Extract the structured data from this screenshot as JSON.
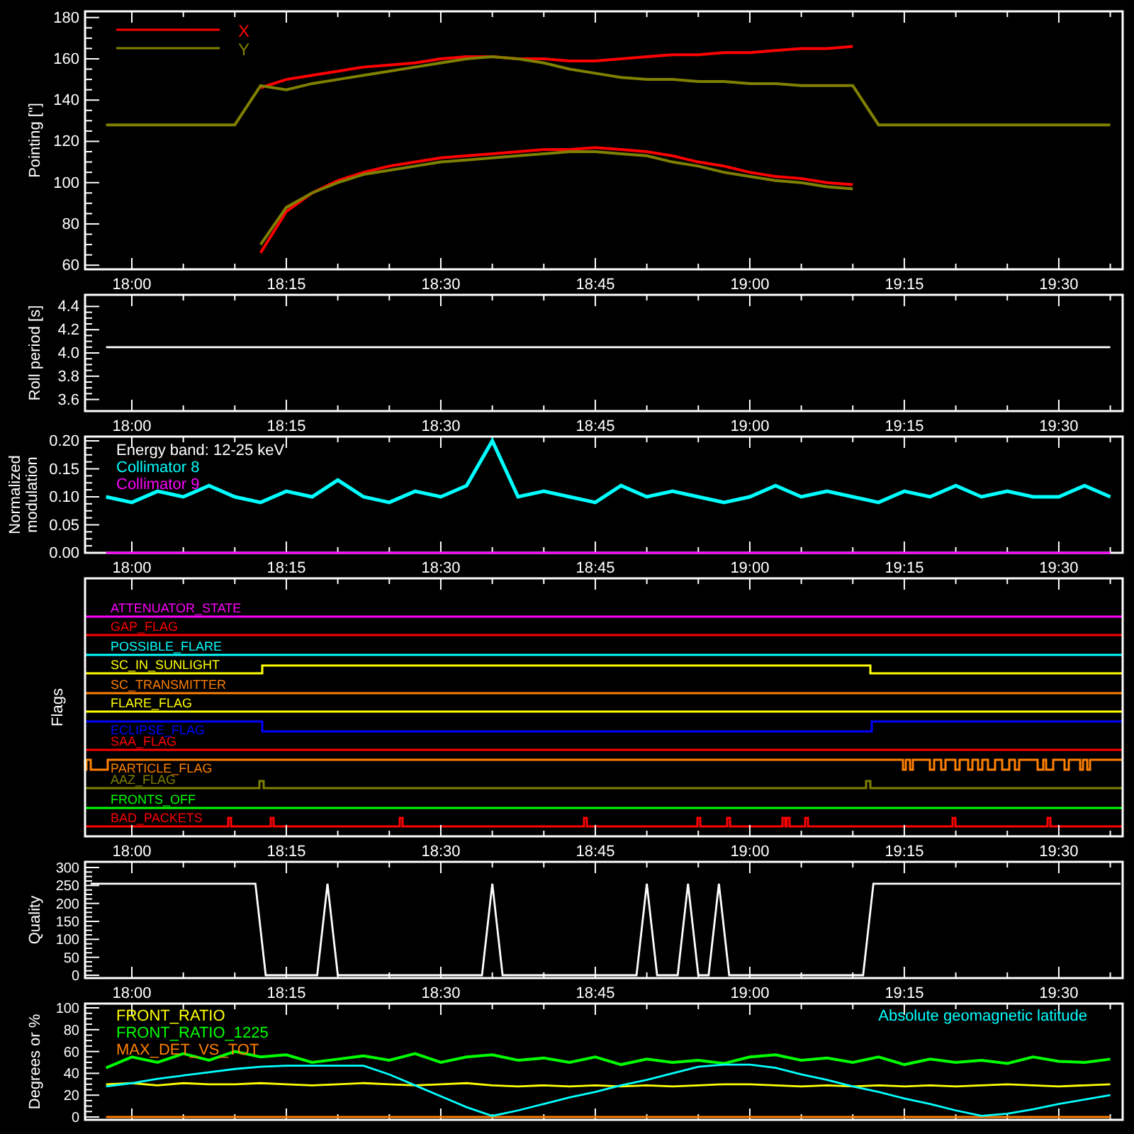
{
  "panels": [
    {
      "kind": "pointing",
      "legend": [
        {
          "label": "X",
          "color": "#ff0000"
        },
        {
          "label": "Y",
          "color": "#808000"
        }
      ],
      "chart_data": {
        "type": "line",
        "ylabel": "Pointing [\"]",
        "ylim": [
          58,
          183
        ],
        "categories": [
          null,
          "18:00",
          null,
          null,
          null,
          null,
          null,
          "18:15",
          null,
          null,
          null,
          null,
          null,
          "18:30",
          null,
          null,
          null,
          null,
          null,
          "18:45",
          null,
          null,
          null,
          null,
          null,
          "19:00",
          null,
          null,
          null,
          null,
          null,
          "19:15",
          null,
          null,
          null,
          null,
          null,
          "19:30",
          null,
          null
        ],
        "yticks": [
          {
            "value": 60,
            "label": "60"
          },
          {
            "value": 80,
            "label": "80"
          },
          {
            "value": 100,
            "label": "100"
          },
          {
            "value": 120,
            "label": "120"
          },
          {
            "value": 140,
            "label": "140"
          },
          {
            "value": 160,
            "label": "160"
          },
          {
            "value": 180,
            "label": "180"
          }
        ],
        "series": [
          {
            "color": "#ff0000",
            "values": [
              null,
              null,
              null,
              null,
              null,
              null,
              146,
              150,
              152,
              154,
              156,
              157,
              158,
              160,
              161,
              161,
              160,
              160,
              159,
              159,
              160,
              161,
              162,
              162,
              163,
              163,
              164,
              165,
              165,
              166,
              null,
              null,
              null,
              null,
              null,
              null,
              null,
              null,
              null,
              null
            ]
          },
          {
            "color": "#ff0000",
            "values": [
              null,
              null,
              null,
              null,
              null,
              null,
              66,
              86,
              95,
              101,
              105,
              108,
              110,
              112,
              113,
              114,
              115,
              116,
              116,
              117,
              116,
              115,
              113,
              110,
              108,
              105,
              103,
              102,
              100,
              99,
              null,
              null,
              null,
              null,
              null,
              null,
              null,
              null,
              null,
              null
            ]
          },
          {
            "color": "#808000",
            "values": [
              128,
              128,
              128,
              128,
              128,
              128,
              147,
              145,
              148,
              150,
              152,
              154,
              156,
              158,
              160,
              161,
              160,
              158,
              155,
              153,
              151,
              150,
              150,
              149,
              149,
              148,
              148,
              147,
              147,
              147,
              128,
              128,
              128,
              128,
              128,
              128,
              128,
              128,
              128,
              128
            ]
          },
          {
            "color": "#808000",
            "values": [
              null,
              null,
              null,
              null,
              null,
              null,
              70,
              88,
              95,
              100,
              104,
              106,
              108,
              110,
              111,
              112,
              113,
              114,
              115,
              115,
              114,
              113,
              110,
              108,
              105,
              103,
              101,
              100,
              98,
              97,
              null,
              null,
              null,
              null,
              null,
              null,
              null,
              null,
              null,
              null
            ]
          }
        ]
      }
    },
    {
      "kind": "roll",
      "chart_data": {
        "type": "line",
        "ylabel": "Roll period [s]",
        "ylim": [
          3.5,
          4.5
        ],
        "categories": [
          null,
          "18:00",
          null,
          null,
          null,
          null,
          null,
          "18:15",
          null,
          null,
          null,
          null,
          null,
          "18:30",
          null,
          null,
          null,
          null,
          null,
          "18:45",
          null,
          null,
          null,
          null,
          null,
          "19:00",
          null,
          null,
          null,
          null,
          null,
          "19:15",
          null,
          null,
          null,
          null,
          null,
          "19:30",
          null,
          null
        ],
        "yticks": [
          {
            "value": 3.6,
            "label": "3.6"
          },
          {
            "value": 3.8,
            "label": "3.8"
          },
          {
            "value": 4.0,
            "label": "4.0"
          },
          {
            "value": 4.2,
            "label": "4.2"
          },
          {
            "value": 4.4,
            "label": "4.4"
          }
        ],
        "series": [
          {
            "color": "#ffffff",
            "values": [
              4.05,
              4.05,
              4.05,
              4.05,
              4.05,
              4.05,
              4.05,
              4.05,
              4.05,
              4.05,
              4.05,
              4.05,
              4.05,
              4.05,
              4.05,
              4.05,
              4.05,
              4.05,
              4.05,
              4.05,
              4.05,
              4.05,
              4.05,
              4.05,
              4.05,
              4.05,
              4.05,
              4.05,
              4.05,
              4.05,
              4.05,
              4.05,
              4.05,
              4.05,
              4.05,
              4.05,
              4.05,
              4.05,
              4.05,
              4.05
            ]
          }
        ]
      }
    },
    {
      "kind": "modulation",
      "chart_data": {
        "type": "line",
        "ylabel": "Normalized modulation",
        "ylim": [
          0,
          0.2076
        ],
        "categories": [
          null,
          "18:00",
          null,
          null,
          null,
          null,
          null,
          "18:15",
          null,
          null,
          null,
          null,
          null,
          "18:30",
          null,
          null,
          null,
          null,
          null,
          "18:45",
          null,
          null,
          null,
          null,
          null,
          "19:00",
          null,
          null,
          null,
          null,
          null,
          "19:15",
          null,
          null,
          null,
          null,
          null,
          "19:30",
          null,
          null
        ],
        "yticks": [
          {
            "value": 0,
            "label": "0.00"
          },
          {
            "value": 0.05,
            "label": "0.05"
          },
          {
            "value": 0.1,
            "label": "0.10"
          },
          {
            "value": 0.15,
            "label": "0.15"
          },
          {
            "value": 0.2,
            "label": "0.20"
          }
        ],
        "annotations": [
          {
            "text": "Energy band: 12-25 keV"
          }
        ],
        "series": [
          {
            "name": "Collimator 8",
            "color": "#00ffff",
            "values": [
              0.1,
              0.09,
              0.11,
              0.1,
              0.12,
              0.1,
              0.09,
              0.11,
              0.1,
              0.13,
              0.1,
              0.09,
              0.11,
              0.1,
              0.12,
              0.2,
              0.1,
              0.11,
              0.1,
              0.09,
              0.12,
              0.1,
              0.11,
              0.1,
              0.09,
              0.1,
              0.12,
              0.1,
              0.11,
              0.1,
              0.09,
              0.11,
              0.1,
              0.12,
              0.1,
              0.11,
              0.1,
              0.1,
              0.12,
              0.1
            ]
          },
          {
            "name": "Collimator 9",
            "color": "#ff00ff",
            "values": [
              0,
              0,
              0,
              0,
              0,
              0,
              0,
              0,
              0,
              0,
              0,
              0,
              0,
              0,
              0,
              0,
              0,
              0,
              0,
              0,
              0,
              0,
              0,
              0,
              0,
              0,
              0,
              0,
              0,
              0,
              0,
              0,
              0,
              0,
              0,
              0,
              0,
              0,
              0,
              0
            ]
          }
        ]
      }
    },
    {
      "kind": "flags",
      "ylabel": "Flags",
      "time_labels": [
        "18:00",
        "18:15",
        "18:30",
        "18:45",
        "19:00",
        "19:15",
        "19:30"
      ],
      "flags": [
        {
          "label": "ATTENUATOR_STATE",
          "color": "#ff00ff"
        },
        {
          "label": "GAP_FLAG",
          "color": "#ff0000"
        },
        {
          "label": "POSSIBLE_FLARE",
          "color": "#00ffff"
        },
        {
          "label": "SC_IN_SUNLIGHT",
          "color": "#ffff00"
        },
        {
          "label": "SC_TRANSMITTER",
          "color": "#ff8000"
        },
        {
          "label": "FLARE_FLAG",
          "color": "#ffff00"
        },
        {
          "label": "ECLIPSE_FLAG",
          "color": "#0000ff"
        },
        {
          "label": "SAA_FLAG",
          "color": "#ff0000"
        },
        {
          "label": "PARTICLE_FLAG",
          "color": "#ff8000"
        },
        {
          "label": "AAZ_FLAG",
          "color": "#808000"
        },
        {
          "label": "FRONTS_OFF",
          "color": "#00ff00"
        },
        {
          "label": "BAD_PACKETS",
          "color": "#ff0000"
        }
      ]
    },
    {
      "kind": "quality",
      "chart_data": {
        "type": "line",
        "ylabel": "Quality",
        "ylim": [
          -7.9,
          315.8
        ],
        "categories": [
          null,
          null,
          null,
          null,
          "18:00",
          null,
          null,
          null,
          null,
          null,
          null,
          null,
          null,
          null,
          null,
          null,
          null,
          null,
          null,
          "18:15",
          null,
          null,
          null,
          null,
          null,
          null,
          null,
          null,
          null,
          null,
          null,
          null,
          null,
          null,
          "18:30",
          null,
          null,
          null,
          null,
          null,
          null,
          null,
          null,
          null,
          null,
          null,
          null,
          null,
          null,
          "18:45",
          null,
          null,
          null,
          null,
          null,
          null,
          null,
          null,
          null,
          null,
          null,
          null,
          null,
          null,
          "19:00",
          null,
          null,
          null,
          null,
          null,
          null,
          null,
          null,
          null,
          null,
          null,
          null,
          null,
          null,
          "19:15",
          null,
          null,
          null,
          null,
          null,
          null,
          null,
          null,
          null,
          null,
          null,
          null,
          null,
          null,
          "19:30",
          null,
          null,
          null,
          null,
          null,
          null
        ],
        "yticks": [
          {
            "value": 0,
            "label": "0"
          },
          {
            "value": 50,
            "label": "50"
          },
          {
            "value": 100,
            "label": "100"
          },
          {
            "value": 150,
            "label": "150"
          },
          {
            "value": 200,
            "label": "200"
          },
          {
            "value": 250,
            "label": "250"
          },
          {
            "value": 300,
            "label": "300"
          }
        ],
        "series": [
          {
            "color": "#ffffff",
            "values": [
              255,
              255,
              255,
              255,
              255,
              255,
              255,
              255,
              255,
              255,
              255,
              255,
              255,
              255,
              255,
              255,
              255,
              0,
              0,
              0,
              0,
              0,
              0,
              255,
              0,
              0,
              0,
              0,
              0,
              0,
              0,
              0,
              0,
              0,
              0,
              0,
              0,
              0,
              0,
              255,
              0,
              0,
              0,
              0,
              0,
              0,
              0,
              0,
              0,
              0,
              0,
              0,
              0,
              0,
              255,
              0,
              0,
              0,
              255,
              0,
              0,
              255,
              0,
              0,
              0,
              0,
              0,
              0,
              0,
              0,
              0,
              0,
              0,
              0,
              0,
              0,
              255,
              255,
              255,
              255,
              255,
              255,
              255,
              255,
              255,
              255,
              255,
              255,
              255,
              255,
              255,
              255,
              255,
              255,
              255,
              255,
              255,
              255,
              255,
              255,
              255
            ]
          }
        ]
      }
    },
    {
      "kind": "degrees",
      "chart_data": {
        "type": "line",
        "ylabel": "Degrees or %",
        "ylim": [
          -2.6,
          103.9
        ],
        "categories": [
          null,
          null,
          null,
          null,
          null,
          null,
          null,
          null,
          null,
          null,
          null,
          null,
          null,
          null,
          null,
          null,
          null,
          null,
          null,
          null,
          null,
          null,
          null,
          null,
          null,
          null,
          null,
          null,
          null,
          null,
          null,
          null,
          null,
          null,
          null,
          null,
          null,
          null,
          null,
          null
        ],
        "yticks": [
          {
            "value": 0,
            "label": "0"
          },
          {
            "value": 20,
            "label": "20"
          },
          {
            "value": 40,
            "label": "40"
          },
          {
            "value": 60,
            "label": "60"
          },
          {
            "value": 80,
            "label": "80"
          },
          {
            "value": 100,
            "label": "100"
          }
        ],
        "annotations": [
          {
            "text": "Absolute geomagnetic latitude"
          }
        ],
        "series": [
          {
            "name": "FRONT_RATIO",
            "color": "#ffff00",
            "values": [
              30,
              31,
              29,
              31,
              30,
              30,
              31,
              30,
              29,
              30,
              31,
              30,
              29,
              30,
              31,
              29,
              28,
              29,
              28,
              29,
              28,
              29,
              28,
              29,
              30,
              30,
              29,
              28,
              29,
              28,
              29,
              28,
              29,
              28,
              29,
              30,
              29,
              28,
              29,
              30
            ]
          },
          {
            "name": "FRONT_RATIO_1225",
            "color": "#00ff00",
            "values": [
              45,
              55,
              50,
              58,
              52,
              60,
              55,
              57,
              50,
              53,
              56,
              52,
              58,
              50,
              55,
              57,
              52,
              54,
              50,
              55,
              48,
              53,
              50,
              52,
              49,
              55,
              57,
              52,
              54,
              50,
              55,
              48,
              53,
              50,
              52,
              49,
              55,
              51,
              50,
              53
            ]
          },
          {
            "name": "MAX_DET_VS_TOT",
            "color": "#ff8000",
            "values": [
              0,
              0,
              0,
              0,
              0,
              0,
              0,
              0,
              0,
              0,
              0,
              0,
              0,
              0,
              0,
              0,
              0,
              0,
              0,
              0,
              0,
              0,
              0,
              0,
              0,
              0,
              0,
              0,
              0,
              0,
              0,
              0,
              0,
              0,
              0,
              0,
              0,
              0,
              0,
              0
            ]
          },
          {
            "color": "#00ffff",
            "values": [
              28,
              31,
              35,
              38,
              41,
              44,
              46,
              47,
              47,
              47,
              47,
              39,
              29,
              19,
              9,
              1,
              6,
              12,
              18,
              23,
              29,
              34,
              40,
              46,
              48,
              48,
              45,
              39,
              34,
              28,
              23,
              17,
              12,
              6,
              1,
              3,
              7,
              12,
              16,
              20
            ]
          }
        ]
      }
    }
  ]
}
